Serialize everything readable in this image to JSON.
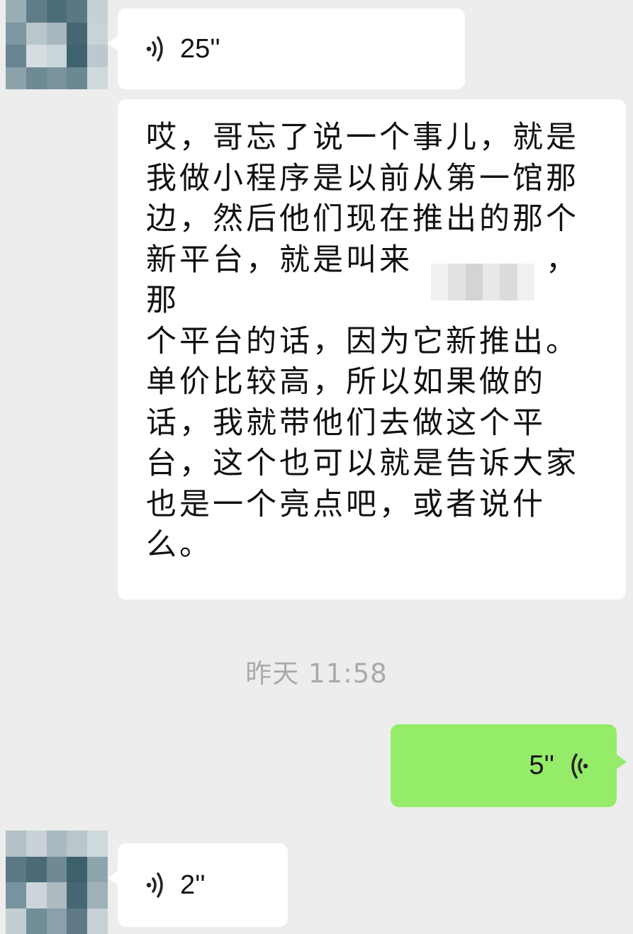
{
  "messages": [
    {
      "id": "m1",
      "sender": "contact",
      "type": "voice",
      "duration": "25''"
    },
    {
      "id": "m2",
      "sender": "contact",
      "type": "text",
      "text": "哎，哥忘了说一个事儿，就是\n我做小程序是以前从第一馆那\n边，然后他们现在推出的那个\n新平台，就是叫来　　　　，那\n个平台的话，因为它新推出。\n单价比较高，所以如果做的\n话，我就带他们去做这个平\n台，这个也可以就是告诉大家\n也是一个亮点吧，或者说什\n么。"
    },
    {
      "id": "m3",
      "sender": "self",
      "type": "voice",
      "duration": "5''"
    },
    {
      "id": "m4",
      "sender": "contact",
      "type": "voice",
      "duration": "2''"
    }
  ],
  "timestamp": "昨天 11:58",
  "colors": {
    "background": "#ededed",
    "incoming_bubble": "#ffffff",
    "outgoing_bubble": "#95ec69",
    "timestamp_text": "#aaaaaa"
  },
  "icons": {
    "incoming_voice": "voice-wave-right-icon",
    "outgoing_voice": "voice-wave-left-icon",
    "avatar": "pixelated-avatar-icon"
  }
}
